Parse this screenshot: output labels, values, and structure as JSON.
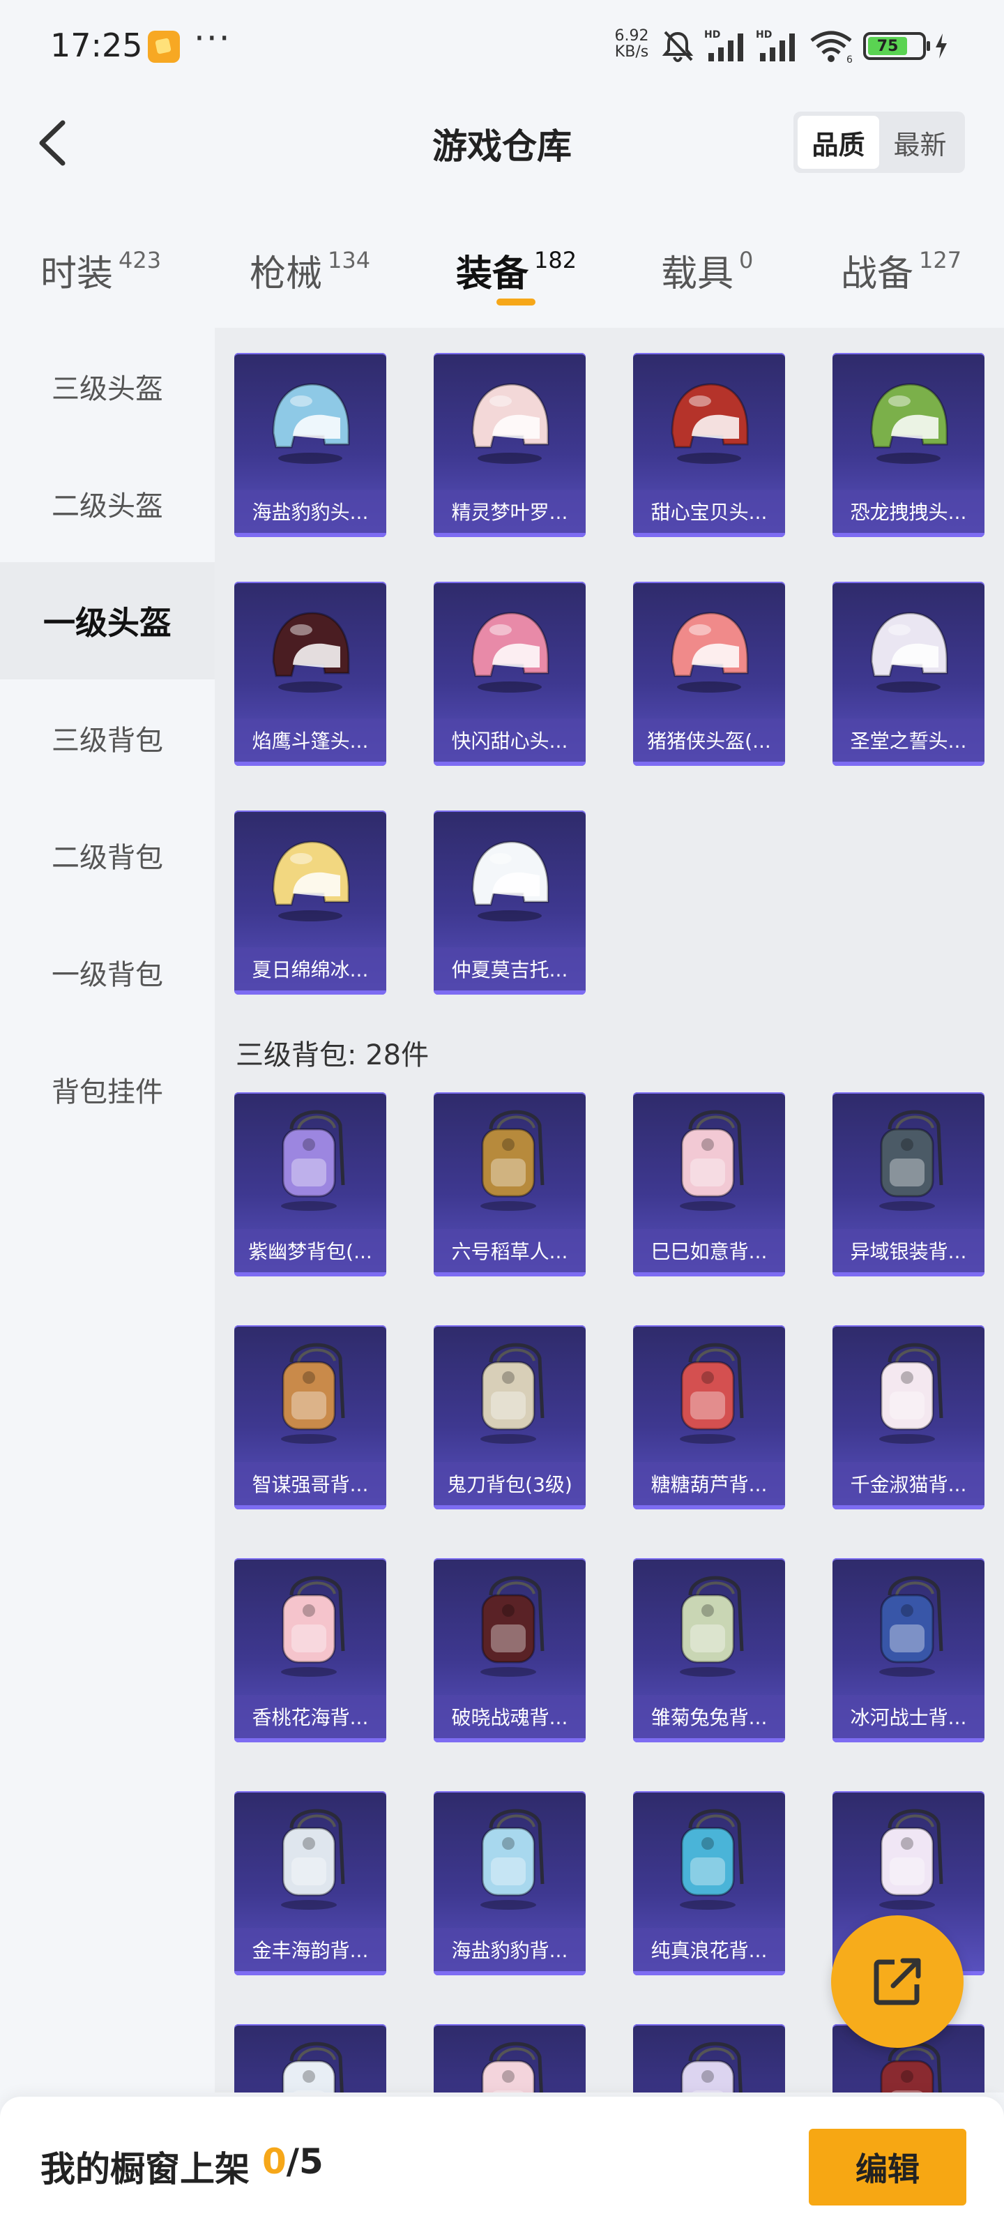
{
  "status_bar": {
    "time": "17:25",
    "speed_value": "6.92",
    "speed_unit": "KB/s",
    "battery": "75",
    "icons": [
      "app-notification-icon",
      "more-dots-icon",
      "mute-icon",
      "signal-hd-icon",
      "signal-hd-icon",
      "wifi-icon",
      "charging-icon"
    ]
  },
  "header": {
    "title": "游戏仓库",
    "sort_options": [
      {
        "label": "品质",
        "active": true
      },
      {
        "label": "最新",
        "active": false
      }
    ]
  },
  "tabs": [
    {
      "label": "时装",
      "count": "423"
    },
    {
      "label": "枪械",
      "count": "134"
    },
    {
      "label": "装备",
      "count": "182",
      "active": true
    },
    {
      "label": "载具",
      "count": "0"
    },
    {
      "label": "战备",
      "count": "127"
    }
  ],
  "sidebar": [
    {
      "label": "三级头盔"
    },
    {
      "label": "二级头盔"
    },
    {
      "label": "一级头盔",
      "active": true
    },
    {
      "label": "三级背包"
    },
    {
      "label": "二级背包"
    },
    {
      "label": "一级背包"
    },
    {
      "label": "背包挂件"
    }
  ],
  "helmets": [
    {
      "name": "海盐豹豹头...",
      "icon": "helmet-icon",
      "color": "#8ec9e6"
    },
    {
      "name": "精灵梦叶罗...",
      "icon": "helmet-icon",
      "color": "#f3d8d8"
    },
    {
      "name": "甜心宝贝头...",
      "icon": "helmet-icon",
      "color": "#b5332a"
    },
    {
      "name": "恐龙拽拽头...",
      "icon": "helmet-icon",
      "color": "#7bb04a"
    },
    {
      "name": "焰鹰斗篷头...",
      "icon": "helmet-icon",
      "color": "#4a1d22"
    },
    {
      "name": "快闪甜心头...",
      "icon": "helmet-icon",
      "color": "#e88aa8"
    },
    {
      "name": "猪猪侠头盔(...",
      "icon": "helmet-icon",
      "color": "#f08a8a"
    },
    {
      "name": "圣堂之誓头...",
      "icon": "helmet-icon",
      "color": "#eae6f2"
    },
    {
      "name": "夏日绵绵冰...",
      "icon": "helmet-icon",
      "color": "#f2d780"
    },
    {
      "name": "仲夏莫吉托...",
      "icon": "helmet-icon",
      "color": "#f4f7fa"
    }
  ],
  "backpack_section": {
    "label": "三级背包: 28件"
  },
  "backpacks": [
    {
      "name": "紫幽梦背包(...",
      "icon": "backpack-icon",
      "color": "#9c86e0"
    },
    {
      "name": "六号稻草人...",
      "icon": "backpack-icon",
      "color": "#b78a3c"
    },
    {
      "name": "巳巳如意背...",
      "icon": "backpack-icon",
      "color": "#f2c9d4"
    },
    {
      "name": "异域银装背...",
      "icon": "backpack-icon",
      "color": "#4b5a66"
    },
    {
      "name": "智谋强哥背...",
      "icon": "backpack-icon",
      "color": "#c98a4a"
    },
    {
      "name": "鬼刀背包(3级)",
      "icon": "backpack-icon",
      "color": "#d8cfb8"
    },
    {
      "name": "糖糖葫芦背...",
      "icon": "backpack-icon",
      "color": "#d45050"
    },
    {
      "name": "千金淑猫背...",
      "icon": "backpack-icon",
      "color": "#f4e8f0"
    },
    {
      "name": "香桃花海背...",
      "icon": "backpack-icon",
      "color": "#f5c4cc"
    },
    {
      "name": "破晓战魂背...",
      "icon": "backpack-icon",
      "color": "#5a2226"
    },
    {
      "name": "雏菊兔兔背...",
      "icon": "backpack-icon",
      "color": "#c9d6b4"
    },
    {
      "name": "冰河战士背...",
      "icon": "backpack-icon",
      "color": "#3856a8"
    },
    {
      "name": "金丰海韵背...",
      "icon": "backpack-icon",
      "color": "#dfe6ee"
    },
    {
      "name": "海盐豹豹背...",
      "icon": "backpack-icon",
      "color": "#a8d8ee"
    },
    {
      "name": "纯真浪花背...",
      "icon": "backpack-icon",
      "color": "#4ab4d8"
    },
    {
      "name": "",
      "icon": "backpack-icon",
      "color": "#f0e6f5"
    },
    {
      "name": "",
      "icon": "backpack-icon",
      "color": "#e8eef5"
    },
    {
      "name": "",
      "icon": "backpack-icon",
      "color": "#f3d4dc"
    },
    {
      "name": "",
      "icon": "backpack-icon",
      "color": "#dcd4f0"
    },
    {
      "name": "",
      "icon": "backpack-icon",
      "color": "#8a2a30"
    }
  ],
  "bottom_bar": {
    "shelf_label": "我的橱窗上架",
    "shelf_count": "0",
    "shelf_total": "/5",
    "edit_label": "编辑"
  },
  "colors": {
    "accent": "#f6a719",
    "card_top": "#2f2b6b",
    "card_bottom": "#5a52c0"
  }
}
